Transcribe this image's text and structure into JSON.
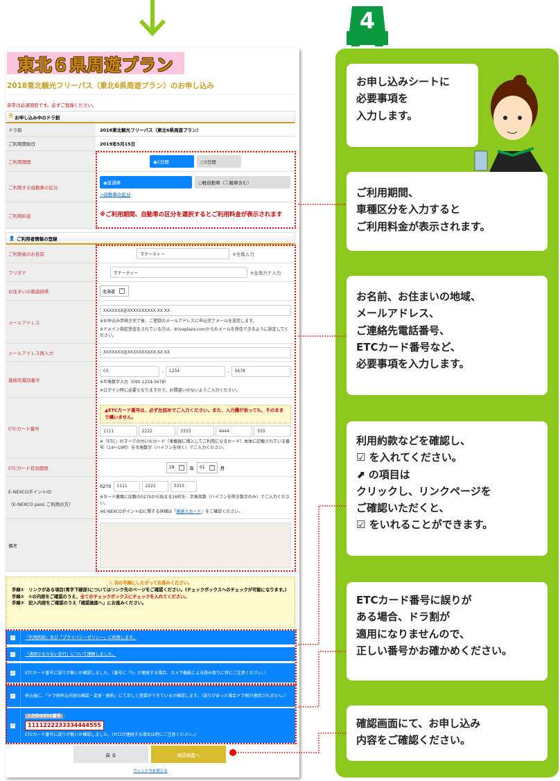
{
  "step_number": "4",
  "colors": {
    "green": "#8cc81e",
    "dark_green": "#0a9a40",
    "blue": "#0a84ff",
    "gold": "#c8a020",
    "red": "#cc0000"
  },
  "form": {
    "banner": "東北６県周遊プラン",
    "title": "2018東北観光フリーパス（東北6県周遊プラン）のお申し込み",
    "required_note": "赤字は必須項目です。必ずご登録ください。",
    "section1": "お申し込み中のドラ割",
    "dora_label": "ドラ割",
    "dora_value": "2018東北観光フリーパス（東北6県周遊プラン）",
    "start_label": "ご利用開始日",
    "start_value": "2019年5月15日",
    "period_label": "ご利用期間",
    "period_opt1": "◉2日間",
    "period_opt2": "○3日間",
    "car_label": "ご利用する自動車の区分",
    "car_opt1": "◉普通車",
    "car_opt2": "○軽自動車（二輪車含む）",
    "car_link": "→自動車の区分",
    "fee_label": "ご利用料金",
    "fee_note": "※ご利用期間、自動車の区分を選択するとご利用料金が表示されます",
    "section2": "ご利用者情報の登録",
    "name_label": "ご利用者のお名前",
    "name_value": "マナーティー",
    "name_hint": "※全角入力",
    "kana_label": "フリガナ",
    "kana_value": "マナーティー",
    "kana_hint": "※全角カナ入力",
    "pref_label": "お住まいの都道府県",
    "pref_value": "北海道",
    "mail_label": "メールアドレス",
    "mail_value": "XXXXXXX@XXXXXXXXXX.XX.XX",
    "mail_note1": "※お申込み手続き完了後、ご登録のメールアドレスに申込完了メールを送信します。",
    "mail_note2": "※ドメイン指定受信をされている方は、driveplaza.comからのメールを受信できるように設定してください。",
    "mail2_label": "メールアドレス再入力",
    "mail2_value": "XXXXXXX@XXXXXXXXXX.XX.XX",
    "tel_label": "連絡先電話番号",
    "tel": [
      "03",
      "1234",
      "5678"
    ],
    "tel_note1": "※半角数字入力（090-1234-5678）",
    "tel_note2": "※ログイン時に必要となりますので、お間違いのないようご入力ください。",
    "etc_label": "ETCカード番号",
    "etc_warn": "▲ETCカード番号は、必ず左詰めでご入力ください。また、入力欄が余っても、そのままで構いません。",
    "etc": [
      "1111",
      "2222",
      "3333",
      "4444",
      "555"
    ],
    "etc_note": "※「ETC」のマークの付いたカード（車載器に挿入してご利用になるカード）本体に記載されている番号（14〜19桁）を半角数字（ハイフンを除く）でご入力ください。",
    "exp_label": "ETCカード有効期限",
    "exp_year": "19",
    "exp_year_unit": "年",
    "exp_month": "01",
    "exp_month_unit": "月",
    "nexco_label": "E-NEXCOポイントID",
    "nexco_sub": "（E-NEXCO pass ご利用の方）",
    "nexco_prefix": "0270",
    "nexco": [
      "1111",
      "2222",
      "3333"
    ],
    "nexco_note1": "※カード裏面に記載の0270から始まる16桁を、半角英数（ハイフンを除き数字のみ）でご入力ください。",
    "nexco_note2a": "※E-NEXCOポイントIDに関する詳細は「",
    "nexco_link": "高速人カード",
    "nexco_note2b": "」をご確認ください。",
    "memo_label": "備考",
    "notice_title": "⚠ 次の手順にしたがってお進みください。",
    "step1": "手順①　リンクがある項目(青字下線部)についてはリンク先のページをご確認ください。(チェックボックスへのチェックが可能になります。)",
    "step2a": "手順②　①の内容をご確認のうえ、",
    "step2b": "全てのチェックボックスにチェックを入れてください。",
    "step3": "手順③　記入内容をご確認のうえ「確認画面へ」にお進みください。",
    "checks": [
      "「利用約款」及び「プライバシーポリシー」に同意します。",
      "「適用とならない走行」について理解しました。",
      "ETCカード番号に誤りが無いか確認しました。（番号に「0」が連続する場合、カメラ機能による読み取りに特にご注意ください。）",
      "申込後に、「ドラ割申込内容の確認・変更・解約」にて正しく登録ができているか確認します。（誤りがあった場合ドラ割が適用されません。）"
    ],
    "etc_current_label": "入力中のETC番号",
    "etc_current": "1111222233334444555",
    "etc_confirm": "ETCカード番号に誤りが無いか確認しました。(ゼロが連続する場合は特にご注意ください。)",
    "back_button": "戻 る",
    "confirm_button": "確認画面へ",
    "close_link": "ウィンドウを閉じる"
  },
  "callouts": [
    "お申し込みシートに\n必要事項を\n入力します。",
    "ご利用期間、\n車種区分を入力すると\nご利用料金が表示されます。",
    "お名前、お住まいの地域、\nメールアドレス、\nご連絡先電話番号、\nETCカード番号など、\n必要事項を入力します。",
    "利用約款などを確認し、\n☑ を入れてください。\n⬈ の項目は\nクリックし、リンクページを\nご確認いただくと、\n☑ をいれることができます。",
    "ETCカード番号に誤りが\nある場合、ドラ割が\n適用になりませんので、\n正しい番号かお確かめください。",
    "確認画面にて、お申し込み\n内容をご確認ください。"
  ]
}
